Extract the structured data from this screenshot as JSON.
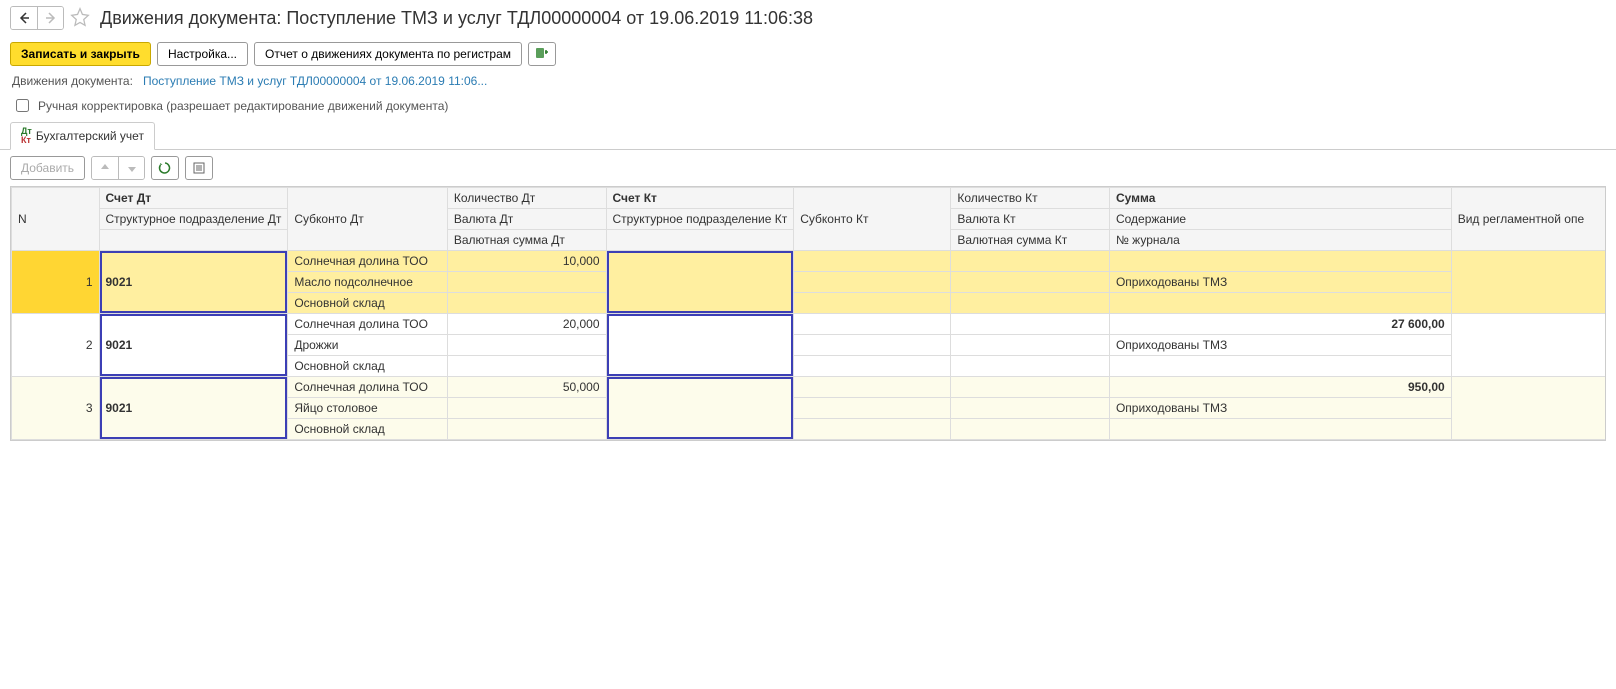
{
  "header": {
    "title": "Движения документа: Поступление ТМЗ и услуг ТДЛ00000004 от 19.06.2019 11:06:38"
  },
  "toolbar": {
    "save_close": "Записать и закрыть",
    "settings": "Настройка...",
    "report": "Отчет о движениях документа по регистрам"
  },
  "breadcrumb": {
    "label": "Движения документа:",
    "link": "Поступление ТМЗ и услуг ТДЛ00000004 от 19.06.2019 11:06..."
  },
  "manual_edit": "Ручная корректировка (разрешает редактирование движений документа)",
  "tab": {
    "accounting": "Бухгалтерский учет"
  },
  "sub_toolbar": {
    "add": "Добавить"
  },
  "grid": {
    "headers": {
      "n": "N",
      "acc_dt": "Счет Дт",
      "dept_dt": "Структурное подразделение Дт",
      "sub_dt": "Субконто Дт",
      "qty_dt": "Количество Дт",
      "cur_dt": "Валюта Дт",
      "cur_sum_dt": "Валютная сумма Дт",
      "acc_kt": "Счет Кт",
      "dept_kt": "Структурное подразделение Кт",
      "sub_kt": "Субконто Кт",
      "qty_kt": "Количество Кт",
      "cur_kt": "Валюта Кт",
      "cur_sum_kt": "Валютная сумма Кт",
      "sum": "Сумма",
      "content": "Содержание",
      "journal": "№ журнала",
      "reg_op": "Вид регламентной опе"
    },
    "rows": [
      {
        "n": "1",
        "acc_dt": "9021",
        "sub1": "Солнечная долина ТОО",
        "sub2": "Масло подсолнечное",
        "sub3": "Основной склад",
        "qty_dt": "10,000",
        "sum": "",
        "content": "Оприходованы ТМЗ"
      },
      {
        "n": "2",
        "acc_dt": "9021",
        "sub1": "Солнечная долина ТОО",
        "sub2": "Дрожжи",
        "sub3": "Основной склад",
        "qty_dt": "20,000",
        "sum": "27 600,00",
        "content": "Оприходованы ТМЗ"
      },
      {
        "n": "3",
        "acc_dt": "9021",
        "sub1": "Солнечная долина ТОО",
        "sub2": "Яйцо столовое",
        "sub3": "Основной склад",
        "qty_dt": "50,000",
        "sum": "950,00",
        "content": "Оприходованы ТМЗ"
      }
    ]
  }
}
